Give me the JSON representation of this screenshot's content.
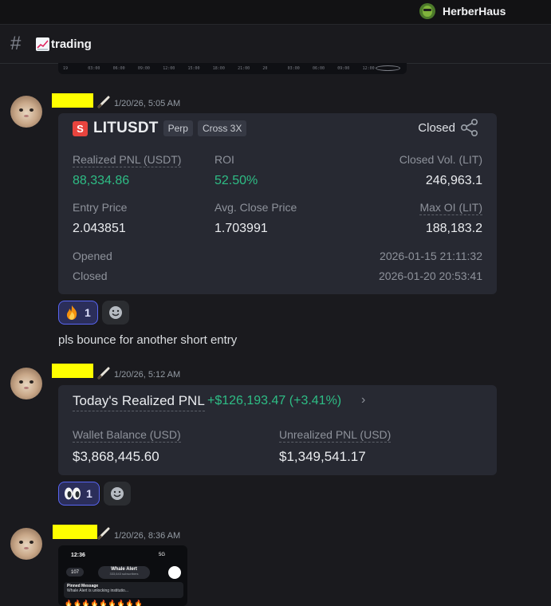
{
  "header": {
    "username": "HerberHaus"
  },
  "channel": {
    "name": "trading",
    "emoji": "chart-increasing-icon"
  },
  "chart_strip": {
    "ticks": [
      "19",
      "03:00",
      "06:00",
      "09:00",
      "12:00",
      "15:00",
      "18:00",
      "21:00",
      "20",
      "03:00",
      "06:00",
      "09:00",
      "12:00"
    ]
  },
  "messages": [
    {
      "timestamp": "1/20/26, 5:05 AM",
      "card": {
        "symbol": "LITUSDT",
        "symbol_icon": "S",
        "tags": [
          "Perp",
          "Cross 3X"
        ],
        "status": "Closed",
        "realized_pnl_label": "Realized PNL (USDT)",
        "realized_pnl_value": "88,334.86",
        "roi_label": "ROI",
        "roi_value": "52.50%",
        "closed_vol_label": "Closed Vol. (LIT)",
        "closed_vol_value": "246,963.1",
        "entry_price_label": "Entry Price",
        "entry_price_value": "2.043851",
        "avg_close_label": "Avg. Close Price",
        "avg_close_value": "1.703991",
        "max_oi_label": "Max OI (LIT)",
        "max_oi_value": "188,183.2",
        "opened_label": "Opened",
        "opened_value": "2026-01-15 21:11:32",
        "closed_label": "Closed",
        "closed_value": "2026-01-20 20:53:41"
      },
      "reaction": {
        "emoji": "fire-icon",
        "count": "1"
      },
      "text": "pls bounce for another short entry"
    },
    {
      "timestamp": "1/20/26, 5:12 AM",
      "card": {
        "title": "Today's Realized PNL",
        "value": "+$126,193.47 (+3.41%)",
        "chevron": "›",
        "wallet_label": "Wallet Balance (USD)",
        "wallet_value": "$3,868,445.60",
        "unrealized_label": "Unrealized PNL (USD)",
        "unrealized_value": "$1,349,541.17"
      },
      "reaction": {
        "emoji": "eyes-icon",
        "count": "1"
      }
    },
    {
      "timestamp": "1/20/26, 8:36 AM",
      "phone": {
        "time": "12:36",
        "signal": "5G",
        "back_count": "107",
        "channel_title": "Whale Alert",
        "channel_subs": "333,643 subscribers",
        "pinned_title": "Pinned Message",
        "pinned_text": "Whale Alert is unlocking institutio...",
        "fires": "🔥🔥🔥🔥🔥🔥🔥🔥🔥"
      }
    }
  ]
}
